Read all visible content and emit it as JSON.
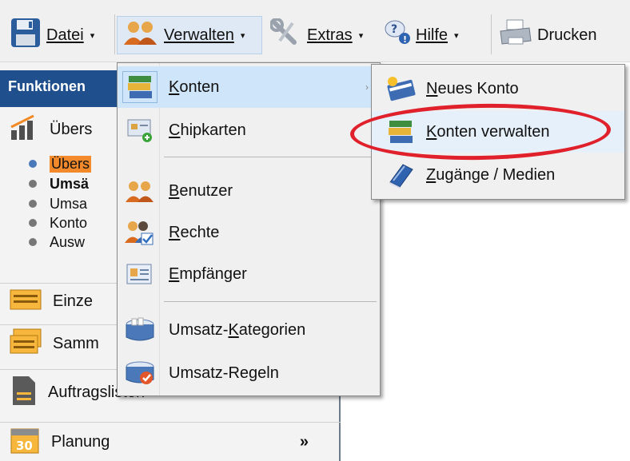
{
  "toolbar": {
    "datei": "Datei",
    "verwalten": "Verwalten",
    "extras": "Extras",
    "hilfe": "Hilfe",
    "drucken": "Drucken",
    "arrow": "▾"
  },
  "panel": {
    "header": "Funktionen",
    "overview": "Übers",
    "bullets": [
      "Übers",
      "Umsä",
      "Umsa",
      "Konto",
      "Ausw"
    ],
    "einzel": "Einze",
    "samm": "Samm",
    "auftragslisten": "Auftragslisten",
    "planung": "Planung",
    "more": "»",
    "calendar_day": "30"
  },
  "menu": {
    "items": [
      {
        "label": "Konten",
        "accel": "K",
        "rest": "onten"
      },
      {
        "label": "Chipkarten",
        "accel": "C",
        "rest": "hipkarten"
      },
      {
        "label": "Benutzer",
        "accel": "B",
        "rest": "enutzer"
      },
      {
        "label": "Rechte",
        "accel": "R",
        "rest": "echte"
      },
      {
        "label": "Empfänger",
        "accel": "E",
        "rest": "mpfänger"
      },
      {
        "label": "Umsatz-Kategorien",
        "pre": "Umsatz-",
        "accel": "K",
        "rest": "ategorien"
      },
      {
        "label": "Umsatz-Regeln",
        "pre": "Umsatz-Re",
        "accel": "g",
        "rest": "eln"
      }
    ],
    "submenu_arrow": "›"
  },
  "submenu": {
    "items": [
      {
        "label": "Neues Konto",
        "accel": "N",
        "rest": "eues Konto"
      },
      {
        "label": "Konten verwalten",
        "accel": "K",
        "rest": "onten verwalten"
      },
      {
        "label": "Zugänge / Medien",
        "accel": "Z",
        "rest": "ugänge / Medien"
      }
    ]
  },
  "colors": {
    "header_blue": "#1f4f8c",
    "highlight_orange": "#f28a2c",
    "annotation_red": "#e0212b",
    "menu_active": "#cfe5fa"
  }
}
